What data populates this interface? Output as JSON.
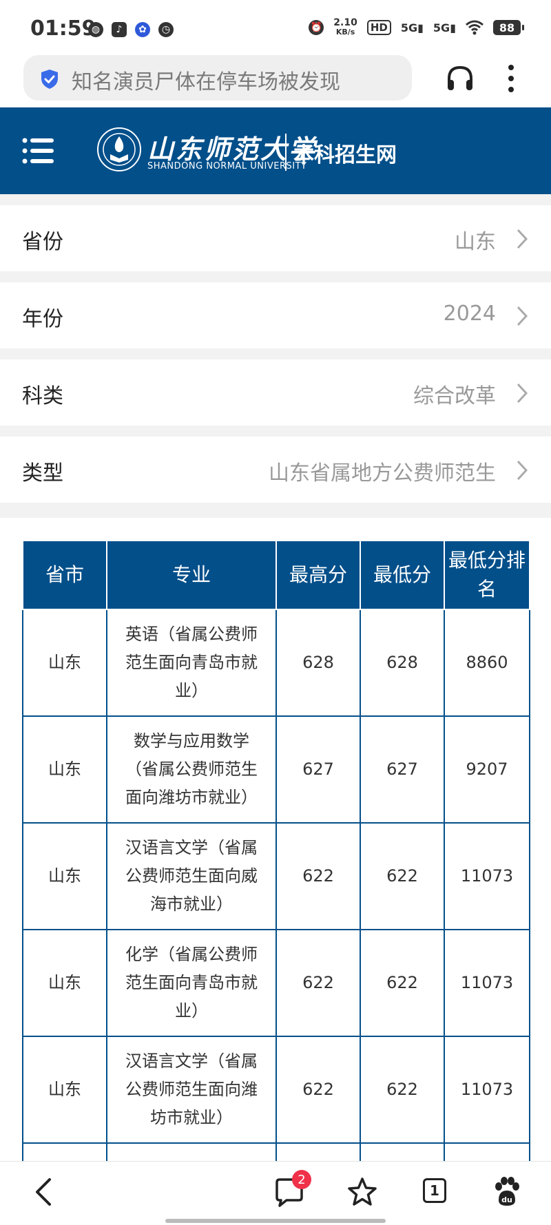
{
  "status_bar": {
    "time": "01:59",
    "net_speed_value": "2.10",
    "net_speed_unit": "KB/s",
    "hd": "HD",
    "signal1": "5G",
    "signal2": "5G",
    "battery": "88"
  },
  "address_bar": {
    "query": "知名演员尸体在停车场被发现"
  },
  "header": {
    "logo_cn": "山东师范大学",
    "logo_en": "SHANDONG NORMAL UNIVERSITY",
    "subtitle": "本科招生网"
  },
  "filters": [
    {
      "label": "省份",
      "value": "山东"
    },
    {
      "label": "年份",
      "value": "2024"
    },
    {
      "label": "科类",
      "value": "综合改革"
    },
    {
      "label": "类型",
      "value": "山东省属地方公费师范生"
    }
  ],
  "table": {
    "headers": [
      "省市",
      "专业",
      "最高分",
      "最低分",
      "最低分排名"
    ],
    "rows": [
      {
        "province": "山东",
        "major": "英语（省属公费师范生面向青岛市就业）",
        "max": "628",
        "min": "628",
        "rank": "8860"
      },
      {
        "province": "山东",
        "major": "数学与应用数学（省属公费师范生面向潍坊市就业）",
        "max": "627",
        "min": "627",
        "rank": "9207"
      },
      {
        "province": "山东",
        "major": "汉语言文学（省属公费师范生面向威海市就业）",
        "max": "622",
        "min": "622",
        "rank": "11073"
      },
      {
        "province": "山东",
        "major": "化学（省属公费师范生面向青岛市就业）",
        "max": "622",
        "min": "622",
        "rank": "11073"
      },
      {
        "province": "山东",
        "major": "汉语言文学（省属公费师范生面向潍坊市就业）",
        "max": "622",
        "min": "622",
        "rank": "11073"
      }
    ]
  },
  "bottom_nav": {
    "comments_badge": "2",
    "tab_count": "1"
  }
}
